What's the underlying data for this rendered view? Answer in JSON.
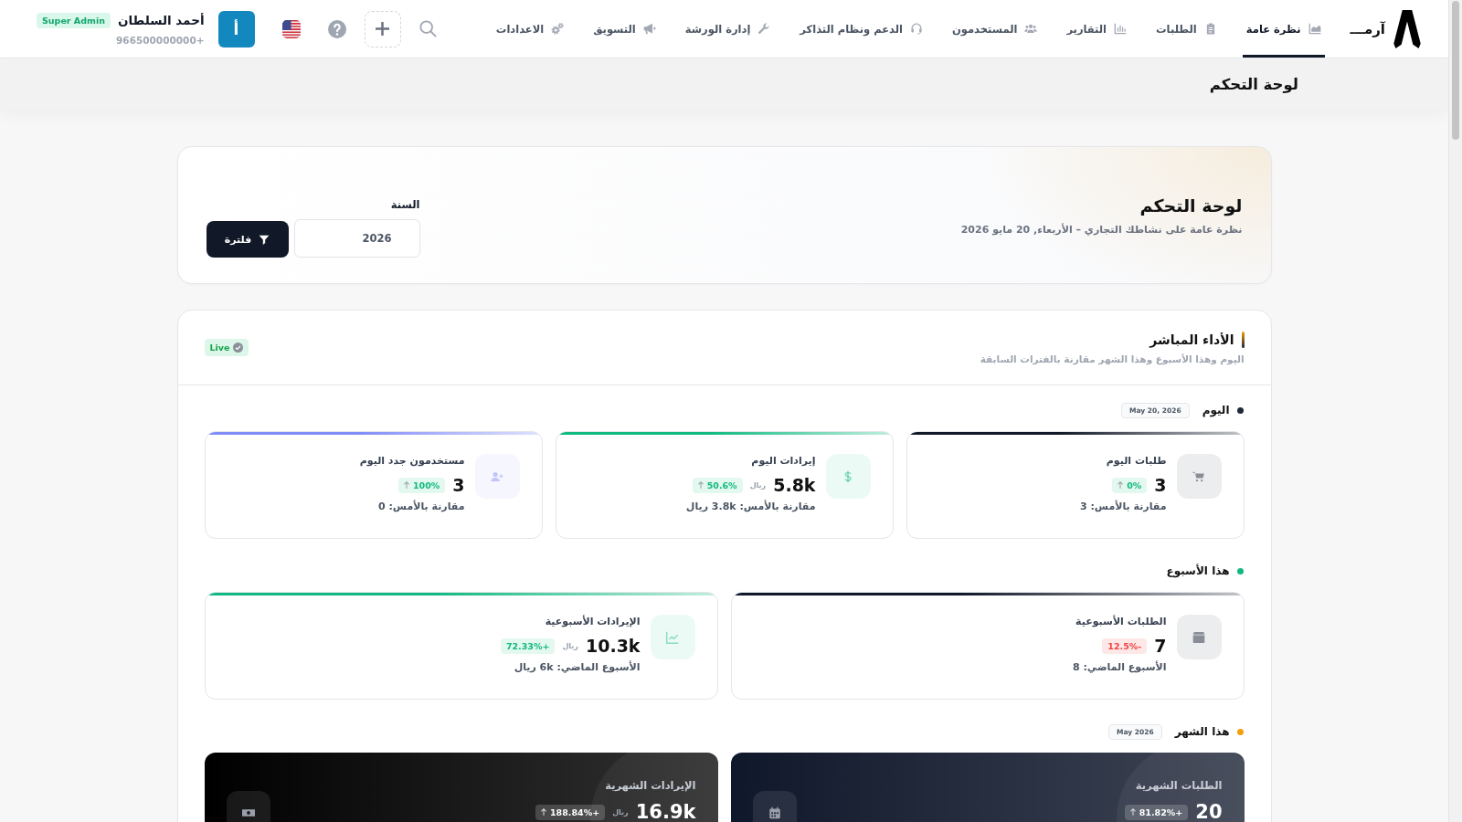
{
  "brand": {
    "name": "آرمـــ"
  },
  "nav": [
    {
      "label": "نظرة عامة",
      "selected": true
    },
    {
      "label": "الطلبات",
      "selected": false
    },
    {
      "label": "التقارير",
      "selected": false
    },
    {
      "label": "المستخدمون",
      "selected": false
    },
    {
      "label": "الدعم ونظام التذاكر",
      "selected": false
    },
    {
      "label": "إدارة الورشة",
      "selected": false
    },
    {
      "label": "التسويق",
      "selected": false
    },
    {
      "label": "الاعدادات",
      "selected": false
    }
  ],
  "user": {
    "initial": "أ",
    "name": "أحمد السلطان",
    "role": "Super Admin",
    "phone": "+966500000000"
  },
  "page_title": "لوحة التحكم",
  "hero": {
    "title": "لوحة التحكم",
    "subtitle": "نظرة عامة على نشاطك التجاري – الأربعاء, 20 مايو 2026",
    "year_label": "السنة",
    "year_value": "2026",
    "filter_button": "فلترة"
  },
  "performance": {
    "title": "الأداء المباشر",
    "subtitle": "اليوم وهذا الأسبوع وهذا الشهر مقارنة بالفترات السابقة",
    "live_badge": "Live",
    "sections": [
      {
        "title": "اليوم",
        "date": "May 20, 2026",
        "color": "#1e293b",
        "cards": [
          {
            "kind": "outline",
            "color": "#111827",
            "title": "طلبات اليوم",
            "value": "3",
            "change": "0%",
            "rising": true,
            "arrow": true,
            "comparison": "مقارنة بالأمس: 3"
          },
          {
            "kind": "outline",
            "color": "#10b981",
            "title": "إيرادات اليوم",
            "value": "5.8k",
            "unit": "ريال",
            "change": "50.6%",
            "rising": true,
            "arrow": true,
            "comparison": "مقارنة بالأمس: 3.8k ريال"
          },
          {
            "kind": "outline",
            "color": "#818cf8",
            "title": "مستخدمون جدد اليوم",
            "value": "3",
            "change": "100%",
            "rising": true,
            "arrow": true,
            "comparison": "مقارنة بالأمس: 0"
          }
        ]
      },
      {
        "title": "هذا الأسبوع",
        "color": "#10b981",
        "cards": [
          {
            "kind": "outline",
            "color": "#111827",
            "title": "الطلبات الأسبوعية",
            "value": "7",
            "change": "-12.5%",
            "rising": false,
            "arrow": false,
            "comparison": "الأسبوع الماضي: 8"
          },
          {
            "kind": "outline",
            "color": "#10b981",
            "title": "الإيرادات الأسبوعية",
            "value": "10.3k",
            "unit": "ريال",
            "change": "+72.33%",
            "rising": true,
            "arrow": false,
            "comparison": "الأسبوع الماضي: 6k ريال"
          }
        ]
      },
      {
        "title": "هذا الشهر",
        "date": "May 2026",
        "color": "#f59e0b",
        "cards": [
          {
            "kind": "dark",
            "color": "#0f172a",
            "title": "الطلبات الشهرية",
            "value": "20",
            "change": "+81.82%",
            "rising": true,
            "arrow": true
          },
          {
            "kind": "dark",
            "color": "#000000",
            "title": "الإيرادات الشهرية",
            "value": "16.9k",
            "unit": "ريال",
            "change": "+188.84%",
            "rising": true,
            "arrow": true
          }
        ]
      }
    ]
  }
}
